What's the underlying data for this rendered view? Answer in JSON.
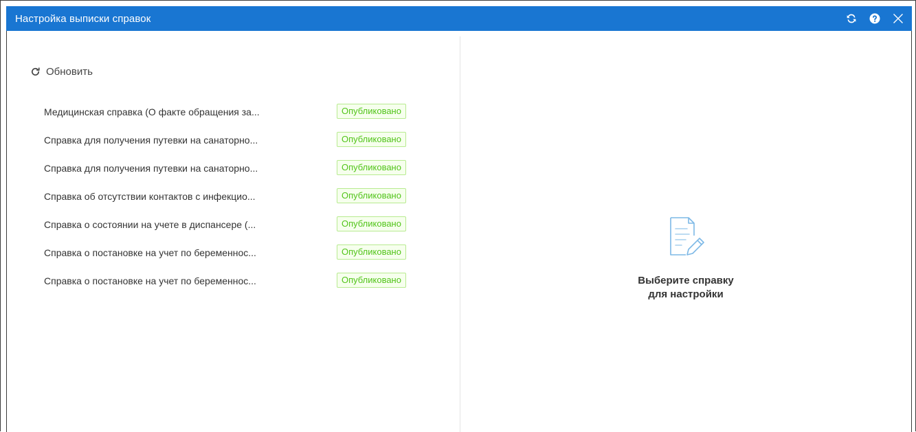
{
  "window": {
    "title": "Настройка выписки справок",
    "accent_color": "#1976d2",
    "controls": [
      "refresh-icon",
      "help-icon",
      "close-icon"
    ]
  },
  "left": {
    "refresh_label": "Обновить",
    "items": [
      {
        "name": "Медицинская справка (О факте обращения за...",
        "status": "Опубликовано"
      },
      {
        "name": "Справка для получения путевки на санаторно...",
        "status": "Опубликовано"
      },
      {
        "name": "Справка для получения путевки на санаторно...",
        "status": "Опубликовано"
      },
      {
        "name": "Справка об отсутствии контактов с инфекцио...",
        "status": "Опубликовано"
      },
      {
        "name": "Справка о состоянии на учете в диспансере (...",
        "status": "Опубликовано"
      },
      {
        "name": "Справка о постановке на учет по беременнос...",
        "status": "Опубликовано"
      },
      {
        "name": "Справка о постановке на учет по беременнос...",
        "status": "Опубликовано"
      }
    ]
  },
  "right": {
    "empty_line1": "Выберите справку",
    "empty_line2": "для настройки",
    "empty_icon": "document-edit-icon"
  }
}
